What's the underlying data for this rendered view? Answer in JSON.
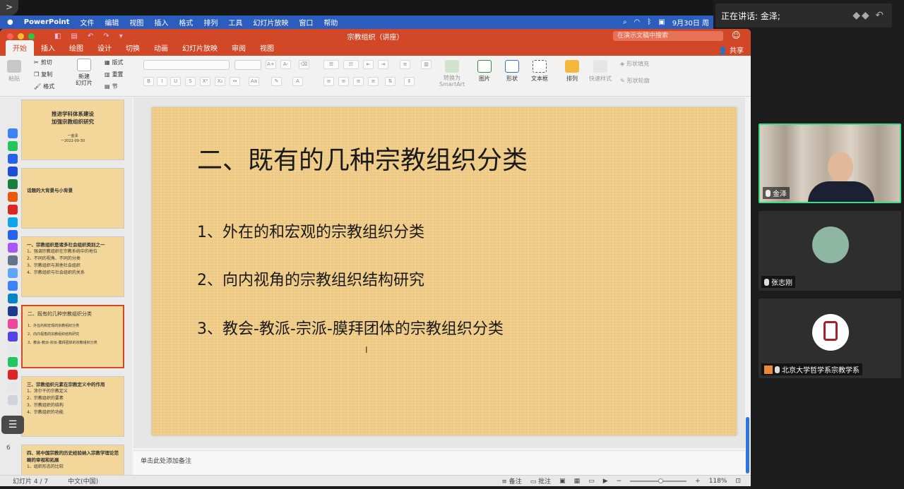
{
  "menubar": {
    "app": "PowerPoint",
    "items": [
      "文件",
      "编辑",
      "视图",
      "插入",
      "格式",
      "排列",
      "工具",
      "幻灯片放映",
      "窗口",
      "帮助"
    ],
    "clock": "9月30日 周"
  },
  "speaking": {
    "label": "正在讲话: 金泽;"
  },
  "window": {
    "title": "宗教组织（讲座）",
    "search_placeholder": "在演示文稿中搜索",
    "share": "共享"
  },
  "ribbon_tabs": [
    "开始",
    "插入",
    "绘图",
    "设计",
    "切换",
    "动画",
    "幻灯片放映",
    "审阅",
    "视图"
  ],
  "ribbon": {
    "paste": "粘贴",
    "cut": "剪切",
    "copy": "复制",
    "format": "格式",
    "new_slide": "新建\n幻灯片",
    "layout": "版式",
    "reset": "重置",
    "section": "节",
    "smartart": "转换为\nSmartArt",
    "picture": "图片",
    "shape": "形状",
    "textbox": "文本框",
    "arrange": "排列",
    "quick_styles": "快速样式",
    "shape_fill": "形状填充",
    "shape_outline": "形状轮廓"
  },
  "thumbnails": [
    {
      "title": "推进学科体系建设\n加强宗教组织研究",
      "sub": "一金泽\n一2022-09-30"
    },
    {
      "title": "话题的大背景与小背景"
    },
    {
      "title": "一、宗教组织是诸多社会组织类别之一",
      "lines": [
        "1、强调宗教组织在宗教系统中的地位",
        "2、不同的视角、不同的分类",
        "3、宗教组织与其他社会组织",
        "4、宗教组织与社会组织的关系"
      ]
    },
    {
      "title": "二、既有的几种宗教组织分类",
      "lines": [
        "1、外在的和宏观的宗教组织分类",
        "2、向内视角的宗教组织结构研究",
        "3、教会-教派-宗派-膜拜团体的宗教组织分类"
      ]
    },
    {
      "title": "三、宗教组织元素在宗教定义中的作用",
      "lines": [
        "1、涂尔干的宗教定义",
        "2、宗教组织的要素",
        "3、宗教组织的结构",
        "4、宗教组织的功能"
      ]
    },
    {
      "title": "四、将中国宗教的历史经验纳入宗教学理论范畴的审视和拓展",
      "lines": [
        "1、组织形态的比较"
      ]
    }
  ],
  "thumb_number": "6",
  "slide": {
    "title": "二、既有的几种宗教组织分类",
    "items": [
      "1、外在的和宏观的宗教组织分类",
      "2、向内视角的宗教组织结构研究",
      "3、教会-教派-宗派-膜拜团体的宗教组织分类"
    ]
  },
  "notes_placeholder": "单击此处添加备注",
  "status": {
    "slide_counter": "幻灯片 4 / 7",
    "language": "中文(中国)",
    "notes": "备注",
    "comments": "批注",
    "zoom": "118%",
    "zoom_fraction": 0.55
  },
  "participants": [
    {
      "name": "金泽",
      "mic": "on"
    },
    {
      "name": "张志刚",
      "mic": "off"
    },
    {
      "name": "北京大学哲学系宗教学系",
      "mic": "off"
    }
  ],
  "colors": {
    "accent": "#d24726",
    "menubar": "#2a5dbd",
    "slide_bg": "#f1cf8c"
  }
}
